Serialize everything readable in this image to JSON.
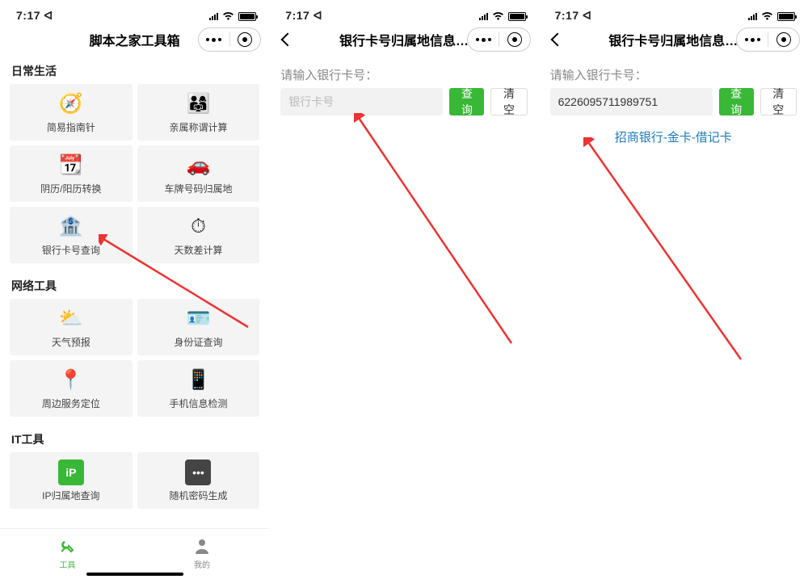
{
  "status": {
    "time": "7:17",
    "location_arrow": "↗"
  },
  "screen1": {
    "title": "脚本之家工具箱",
    "sections": [
      {
        "title": "日常生活",
        "items": [
          {
            "icon": "🧭",
            "label": "简易指南针"
          },
          {
            "icon": "👨‍👩‍👧",
            "label": "亲属称谓计算"
          },
          {
            "icon": "📆",
            "label": "阴历/阳历转换"
          },
          {
            "icon": "🚗",
            "label": "车牌号码归属地"
          },
          {
            "icon": "🏦",
            "label": "银行卡号查询"
          },
          {
            "icon": "⏱",
            "label": "天数差计算"
          }
        ]
      },
      {
        "title": "网络工具",
        "items": [
          {
            "icon": "⛅",
            "label": "天气预报"
          },
          {
            "icon": "🪪",
            "label": "身份证查询"
          },
          {
            "icon": "📍",
            "label": "周边服务定位"
          },
          {
            "icon": "📱",
            "label": "手机信息检测"
          }
        ]
      },
      {
        "title": "IT工具",
        "items": [
          {
            "icon": "iP",
            "label": "IP归属地查询"
          },
          {
            "icon": "⚙️",
            "label": "随机密码生成"
          }
        ]
      }
    ],
    "tabbar": [
      {
        "label": "工具"
      },
      {
        "label": "我的"
      }
    ]
  },
  "screen2": {
    "title": "银行卡号归属地信息…",
    "prompt": "请输入银行卡号：",
    "placeholder": "银行卡号",
    "query": "查询",
    "clear": "清空"
  },
  "screen3": {
    "title": "银行卡号归属地信息…",
    "prompt": "请输入银行卡号：",
    "value": "6226095711989751",
    "query": "查询",
    "clear": "清空",
    "result": "招商银行-金卡-借记卡"
  }
}
